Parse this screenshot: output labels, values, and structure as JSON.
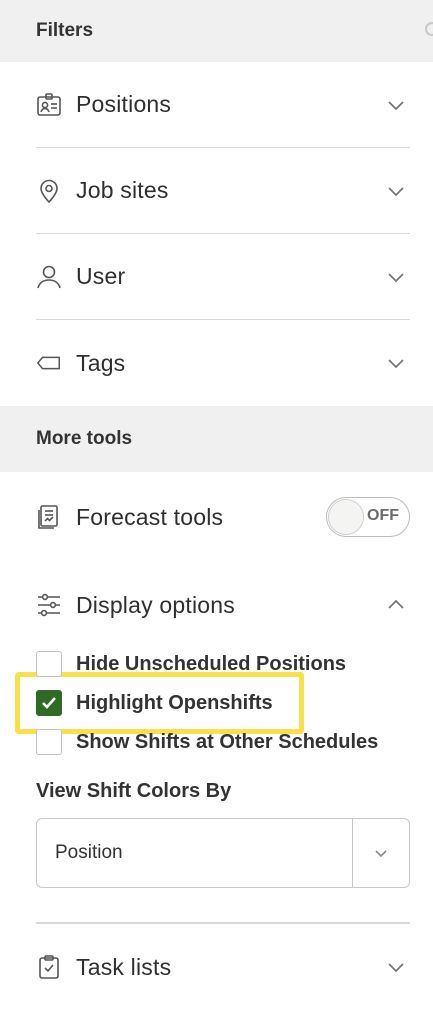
{
  "filters": {
    "header": "Filters",
    "items": [
      {
        "label": "Positions",
        "icon": "id-badge-icon"
      },
      {
        "label": "Job sites",
        "icon": "map-pin-icon"
      },
      {
        "label": "User",
        "icon": "user-icon"
      },
      {
        "label": "Tags",
        "icon": "tag-icon"
      }
    ]
  },
  "more_tools": {
    "header": "More tools",
    "forecast": {
      "label": "Forecast tools",
      "toggle_text": "OFF"
    },
    "display": {
      "label": "Display options",
      "options": [
        {
          "label": "Hide Unscheduled Positions",
          "checked": false
        },
        {
          "label": "Highlight Openshifts",
          "checked": true
        },
        {
          "label": "Show Shifts at Other Schedules",
          "checked": false
        }
      ],
      "shift_colors_label": "View Shift Colors By",
      "shift_colors_value": "Position"
    },
    "task_lists": {
      "label": "Task lists"
    }
  },
  "colors": {
    "checked": "#2f6b24",
    "highlight": "#f7e04a",
    "header_bg": "#f0f0f0"
  }
}
